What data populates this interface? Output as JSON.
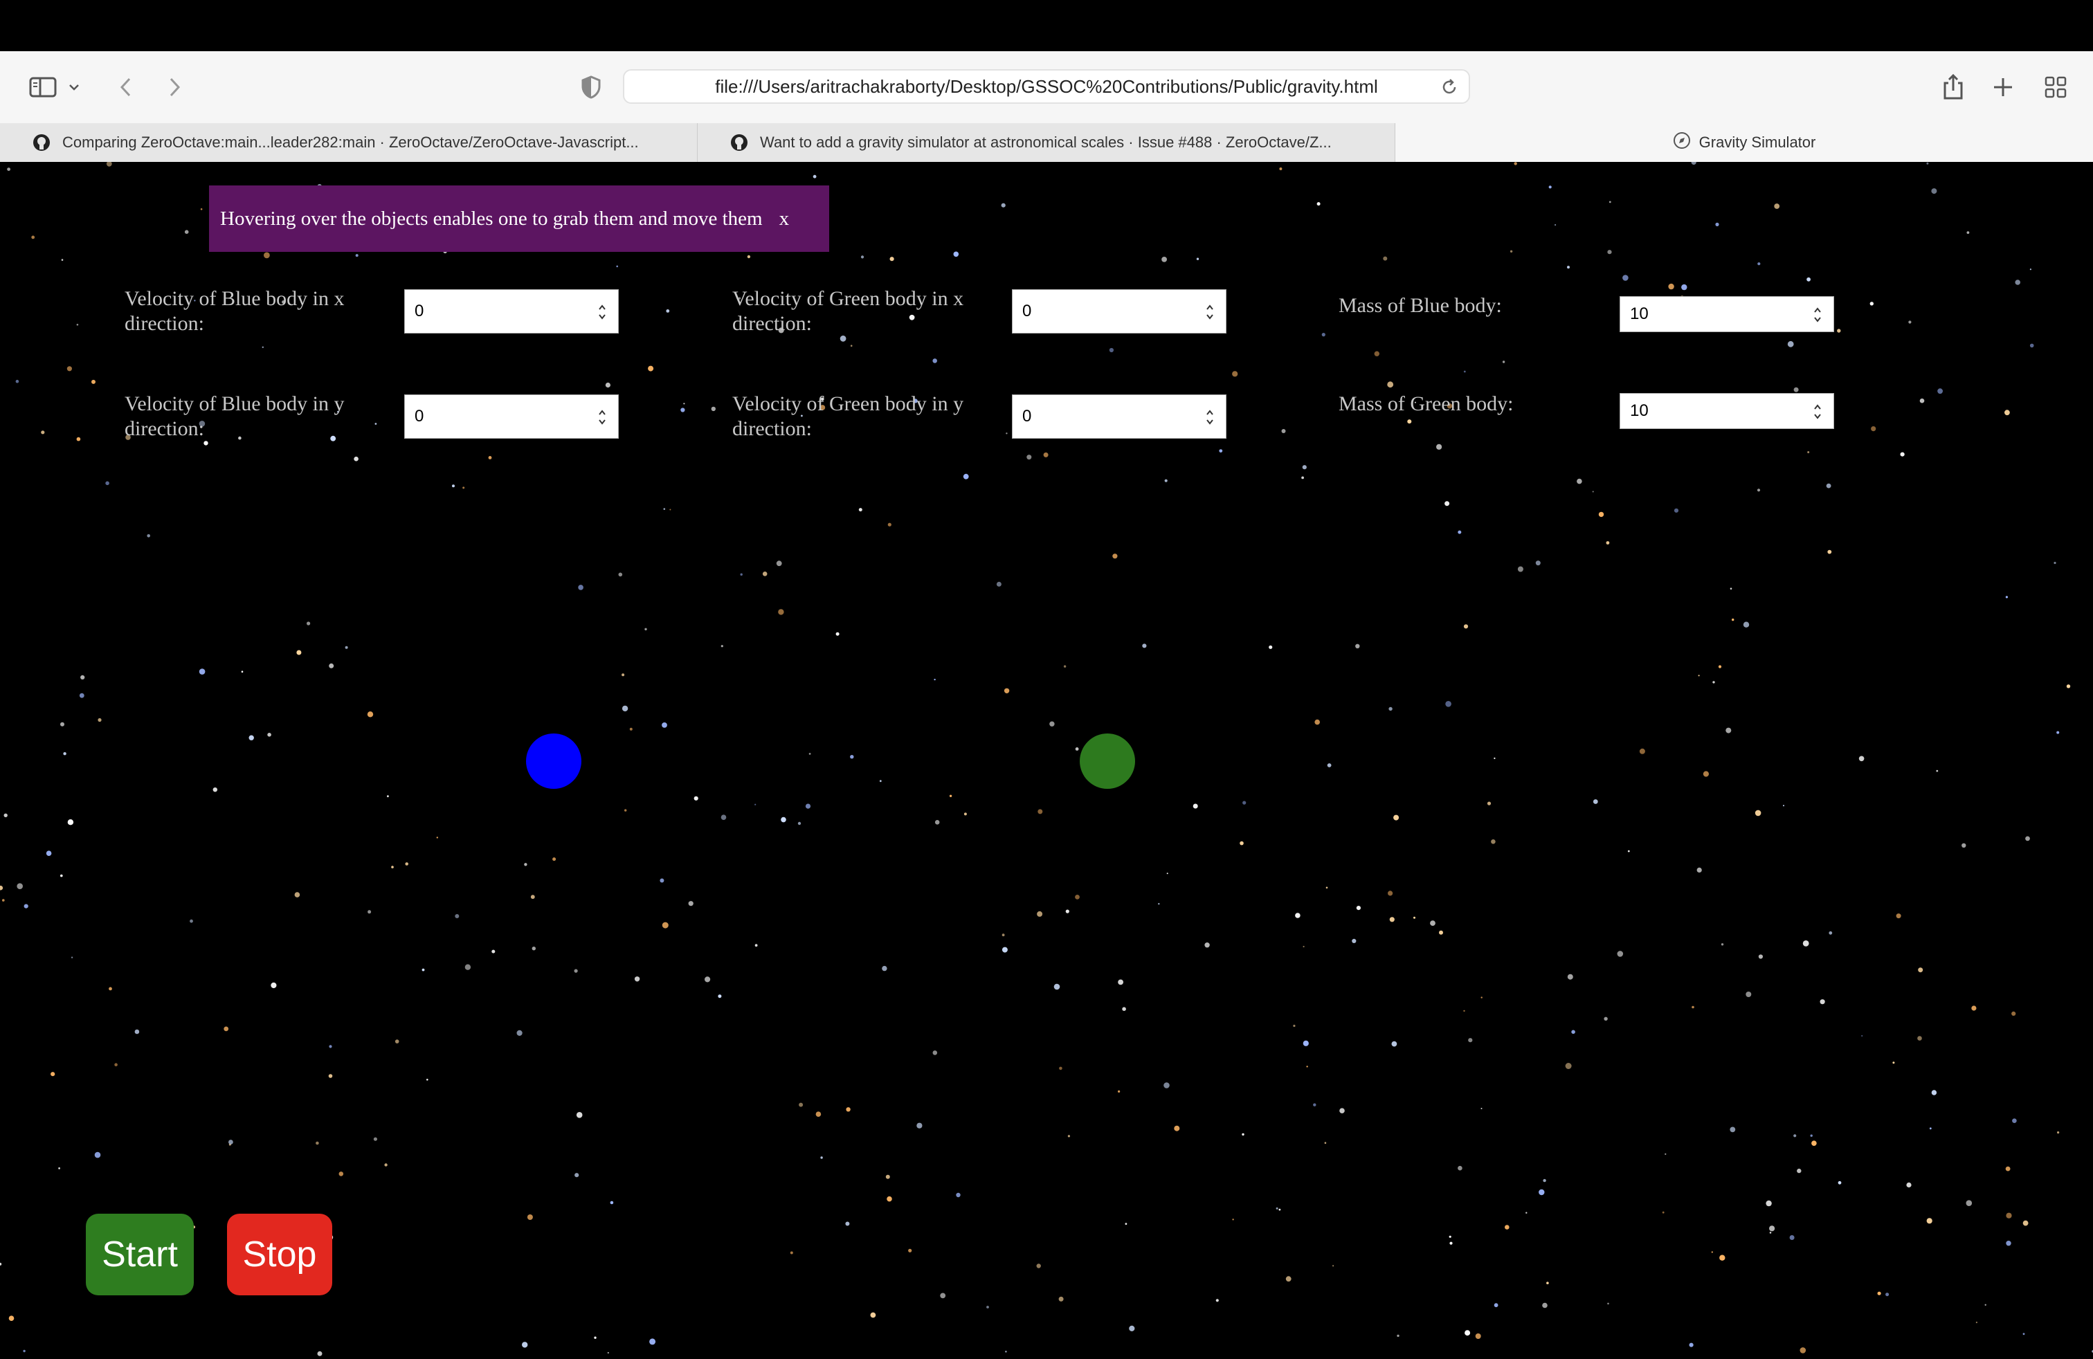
{
  "browser": {
    "url": "file:///Users/aritrachakraborty/Desktop/GSSOC%20Contributions/Public/gravity.html",
    "tabs": [
      {
        "label": "Comparing ZeroOctave:main...leader282:main · ZeroOctave/ZeroOctave-Javascript..."
      },
      {
        "label": "Want to add a gravity simulator at astronomical scales · Issue #488 · ZeroOctave/Z..."
      },
      {
        "label": "Gravity Simulator"
      }
    ]
  },
  "notice": {
    "text": "Hovering over the objects enables one to grab them and move them",
    "close": "x"
  },
  "controls": {
    "blue_vx": {
      "label": "Velocity of Blue body in x direction:",
      "value": "0"
    },
    "blue_vy": {
      "label": "Velocity of Blue body in y direction:",
      "value": "0"
    },
    "green_vx": {
      "label": "Velocity of Green body in x direction:",
      "value": "0"
    },
    "green_vy": {
      "label": "Velocity of Green body in y direction:",
      "value": "0"
    },
    "blue_mass": {
      "label": "Mass of Blue body:",
      "value": "10"
    },
    "green_mass": {
      "label": "Mass of Green body:",
      "value": "10"
    }
  },
  "buttons": {
    "start": "Start",
    "stop": "Stop"
  },
  "colors": {
    "blue_body": "#0000ff",
    "green_body": "#2d7a1e",
    "start": "#2e7d1f",
    "stop": "#e2281f",
    "notice_bg": "#5c1561"
  }
}
